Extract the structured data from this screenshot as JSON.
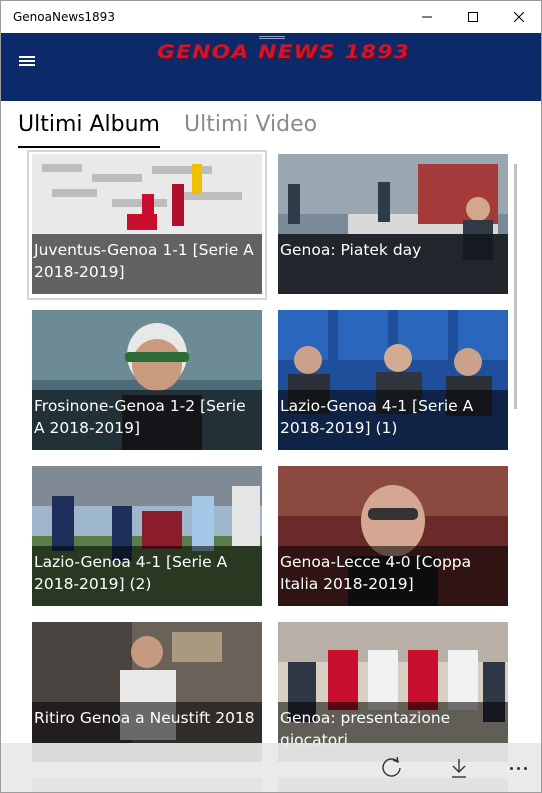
{
  "window": {
    "title": "GenoaNews1893"
  },
  "header": {
    "logo_text": "GENOA NEWS 1893",
    "colors": {
      "background": "#0c2a6a",
      "logo": "#d0142c"
    }
  },
  "tabs": [
    {
      "label": "Ultimi Album",
      "active": true
    },
    {
      "label": "Ultimi Video",
      "active": false
    }
  ],
  "albums": [
    {
      "caption": "Juventus-Genoa 1-1 [Serie A 2018-2019]"
    },
    {
      "caption": "Genoa: Piatek day"
    },
    {
      "caption": "Frosinone-Genoa 1-2 [Serie A 2018-2019]"
    },
    {
      "caption": "Lazio-Genoa 4-1 [Serie A 2018-2019] (1)"
    },
    {
      "caption": "Lazio-Genoa 4-1 [Serie A 2018-2019] (2)"
    },
    {
      "caption": "Genoa-Lecce 4-0 [Coppa Italia 2018-2019]"
    },
    {
      "caption": "Ritiro Genoa a Neustift 2018"
    },
    {
      "caption": "Genoa: presentazione giocatori"
    }
  ],
  "appbar": {
    "icons": [
      "refresh-icon",
      "download-icon",
      "more-icon"
    ]
  }
}
